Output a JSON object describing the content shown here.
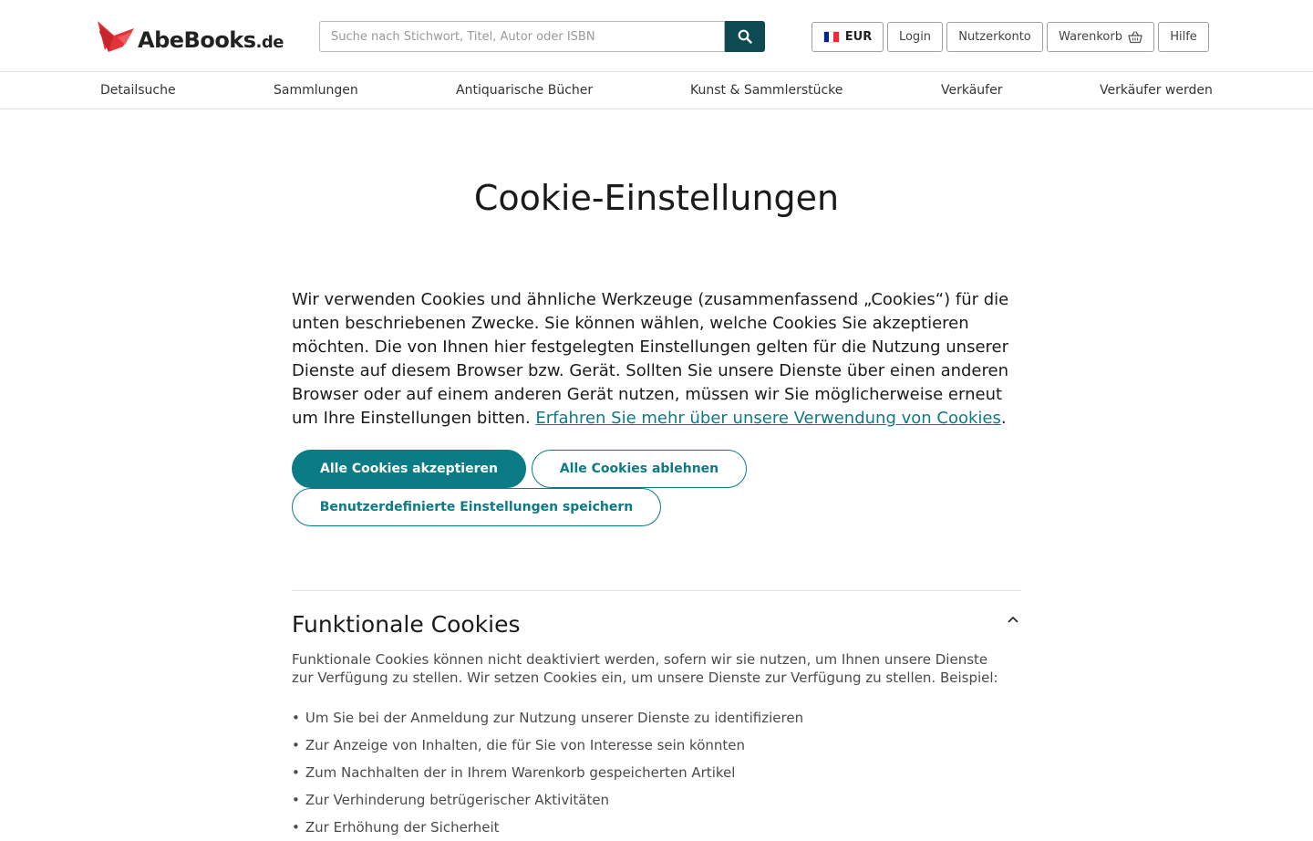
{
  "header": {
    "logo": {
      "name": "AbeBooks",
      "tld": ".de"
    },
    "search": {
      "placeholder": "Suche nach Stichwort, Titel, Autor oder ISBN",
      "value": ""
    },
    "currency": {
      "label": "EUR",
      "flag_colors": [
        "#002395",
        "#ffffff",
        "#ed2939"
      ]
    },
    "login_label": "Login",
    "account_label": "Nutzerkonto",
    "cart_label": "Warenkorb",
    "help_label": "Hilfe"
  },
  "nav": {
    "items": [
      {
        "label": "Detailsuche"
      },
      {
        "label": "Sammlungen"
      },
      {
        "label": "Antiquarische Bücher"
      },
      {
        "label": "Kunst & Sammlerstücke"
      },
      {
        "label": "Verkäufer"
      },
      {
        "label": "Verkäufer werden"
      }
    ]
  },
  "main": {
    "title": "Cookie-Einstellungen",
    "intro_text": "Wir verwenden Cookies und ähnliche Werkzeuge (zusammenfassend „Cookies“) für die unten beschriebenen Zwecke. Sie können wählen, welche Cookies Sie akzeptieren möchten. Die von Ihnen hier festgelegten Einstellungen gelten für die Nutzung unserer Dienste auf diesem Browser bzw. Gerät. Sollten Sie unsere Dienste über einen anderen Browser oder auf einem anderen Gerät nutzen, müssen wir Sie möglicherweise erneut um Ihre Einstellungen bitten.",
    "intro_link": "Erfahren Sie mehr über unsere Verwendung von Cookies",
    "intro_end": ".",
    "buttons": {
      "accept_all": "Alle Cookies akzeptieren",
      "reject_all": "Alle Cookies ablehnen",
      "save_custom": "Benutzerdefinierte Einstellungen speichern"
    },
    "functional": {
      "title": "Funktionale Cookies",
      "description": "Funktionale Cookies können nicht deaktiviert werden, sofern wir sie nutzen, um Ihnen unsere Dienste zur Verfügung zu stellen. Wir setzen Cookies ein, um unsere Dienste zur Verfügung zu stellen. Beispiel:",
      "items": [
        "Um Sie bei der Anmeldung zur Nutzung unserer Dienste zu identifizieren",
        "Zur Anzeige von Inhalten, die für Sie von Interesse sein könnten",
        "Zum Nachhalten der in Ihrem Warenkorb gespeicherten Artikel",
        "Zur Verhinderung betrügerischer Aktivitäten",
        "Zur Erhöhung der Sicherheit"
      ]
    }
  },
  "colors": {
    "accent": "#0b7b86",
    "search_button": "#0d4a52",
    "logo_red": "#e0343a"
  }
}
